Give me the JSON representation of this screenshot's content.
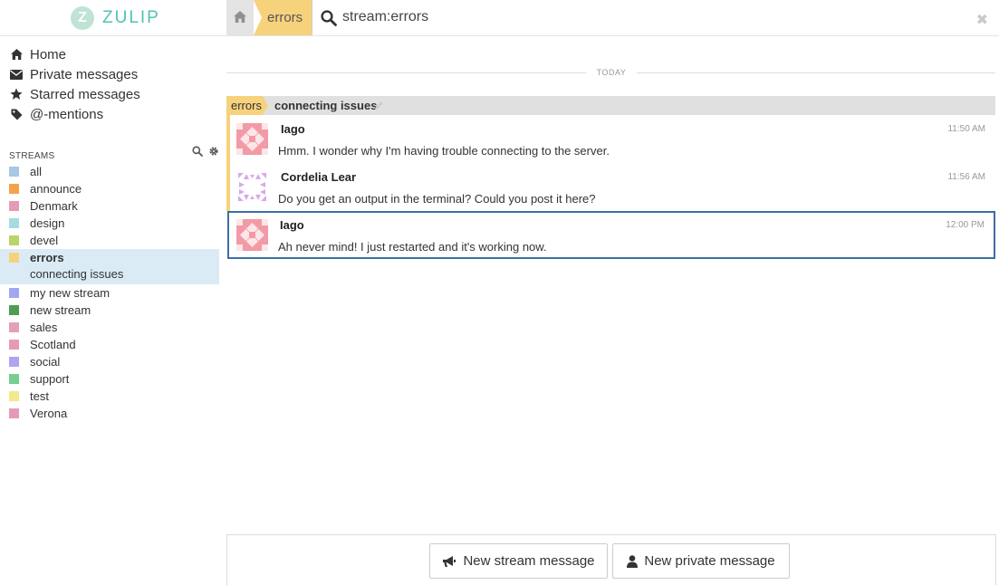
{
  "brand": {
    "name": "ZULIP",
    "logo_letter": "Z",
    "color": "#52c2af"
  },
  "search": {
    "stream_crumb": "errors",
    "query": "stream:errors",
    "close_glyph": "✖"
  },
  "nav": [
    {
      "label": "Home",
      "icon": "home-icon"
    },
    {
      "label": "Private messages",
      "icon": "envelope-icon"
    },
    {
      "label": "Starred messages",
      "icon": "star-icon"
    },
    {
      "label": "@-mentions",
      "icon": "tag-icon"
    }
  ],
  "streams_header": "STREAMS",
  "streams": [
    {
      "name": "all",
      "color": "#a6c7e5"
    },
    {
      "name": "announce",
      "color": "#f4a34a"
    },
    {
      "name": "Denmark",
      "color": "#e79ab5"
    },
    {
      "name": "design",
      "color": "#a3dde0"
    },
    {
      "name": "devel",
      "color": "#b8d565"
    },
    {
      "name": "errors",
      "color": "#f7d27d",
      "active": true,
      "topic": "connecting issues"
    },
    {
      "name": "my new stream",
      "color": "#9fa7f2"
    },
    {
      "name": "new stream",
      "color": "#4f9d54"
    },
    {
      "name": "sales",
      "color": "#e3a1b9"
    },
    {
      "name": "Scotland",
      "color": "#e79ab5"
    },
    {
      "name": "social",
      "color": "#b2a3f0"
    },
    {
      "name": "support",
      "color": "#76ce90"
    },
    {
      "name": "test",
      "color": "#f3e98a"
    },
    {
      "name": "Verona",
      "color": "#e79ab5"
    }
  ],
  "date_separator": "TODAY",
  "recipient": {
    "stream": "errors",
    "topic": "connecting issues"
  },
  "messages": [
    {
      "sender": "Iago",
      "time": "11:50 AM",
      "body": "Hmm. I wonder why I'm having trouble connecting to the server.",
      "avatar": "iago-avatar"
    },
    {
      "sender": "Cordelia Lear",
      "time": "11:56 AM",
      "body": "Do you get an output in the terminal? Could you post it here?",
      "avatar": "cordelia-avatar"
    },
    {
      "sender": "Iago",
      "time": "12:00 PM",
      "body": "Ah never mind! I just restarted and it's working now.",
      "avatar": "iago-avatar",
      "selected": true
    }
  ],
  "compose": {
    "new_stream_label": "New stream message",
    "new_private_label": "New private message"
  },
  "colors": {
    "selected_border": "#3d6ea5",
    "active_stream_bg": "#dbebf5"
  }
}
